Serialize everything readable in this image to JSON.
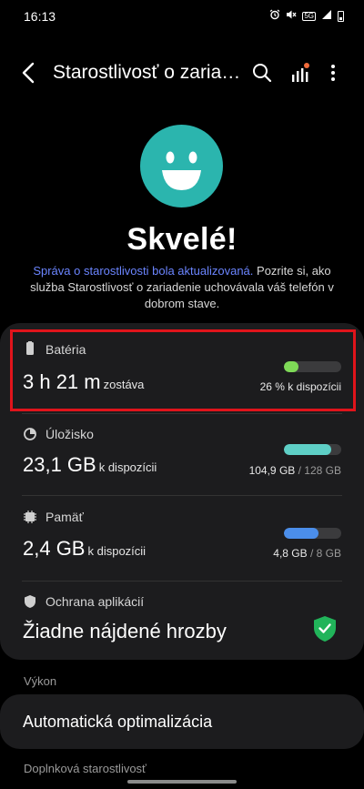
{
  "status_bar": {
    "time": "16:13",
    "network": "5G"
  },
  "app_bar": {
    "title": "Starostlivosť o zaria…"
  },
  "hero": {
    "headline": "Skvelé!",
    "link_text": "Správa o starostlivosti bola aktualizovaná.",
    "summary_text": " Pozrite si, ako služba Starostlivosť o zariadenie uchovávala váš telefón v dobrom stave."
  },
  "battery": {
    "label": "Batéria",
    "time_value": "3 h 21 m",
    "time_suffix": "zostáva",
    "status": "26 % k dispozícii",
    "level": 0.26,
    "color": "#7ed957"
  },
  "storage": {
    "label": "Úložisko",
    "value": "23,1 GB",
    "suffix": "k dispozícii",
    "used": "104,9 GB",
    "total": "/ 128 GB",
    "used_fraction": 0.82,
    "color": "#5ecfc6"
  },
  "memory": {
    "label": "Pamäť",
    "value": "2,4 GB",
    "suffix": "k dispozícii",
    "used": "4,8 GB",
    "total": "/ 8 GB",
    "used_fraction": 0.6,
    "color": "#4b8eea"
  },
  "app_protection": {
    "label": "Ochrana aplikácií",
    "value": "Žiadne nájdené hrozby",
    "shield_color": "#21b45a"
  },
  "performance": {
    "section_label": "Výkon",
    "item": "Automatická optimalizácia"
  },
  "additional": {
    "section_label": "Doplnková starostlivosť"
  }
}
